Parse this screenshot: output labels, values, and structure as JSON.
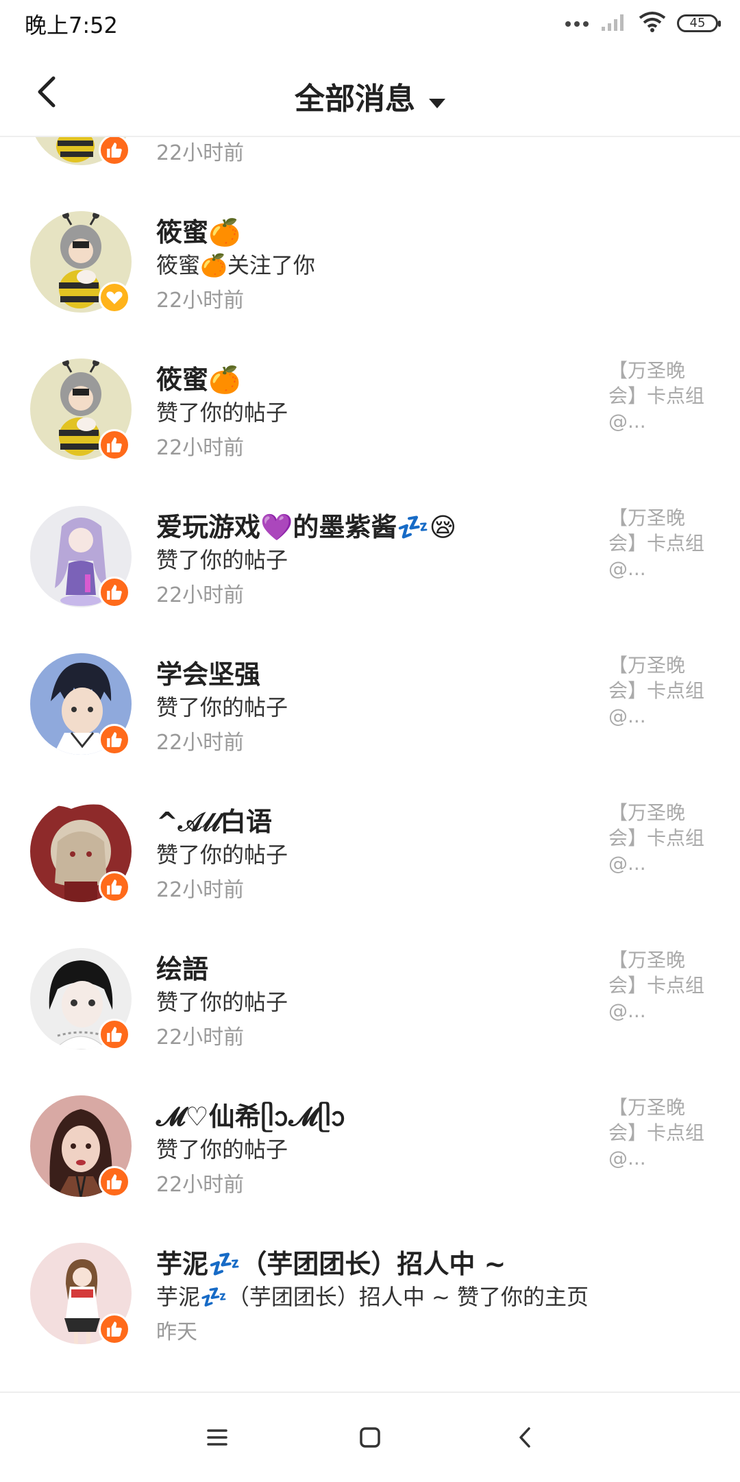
{
  "status_bar": {
    "time": "晚上7:52",
    "battery": "45"
  },
  "header": {
    "title": "全部消息"
  },
  "notifications": [
    {
      "name": "",
      "action": "",
      "time": "22小时前",
      "ref": []
    },
    {
      "name": "筱蜜🍊",
      "action": "筱蜜🍊关注了你",
      "time": "22小时前",
      "ref": []
    },
    {
      "name": "筱蜜🍊",
      "action": "赞了你的帖子",
      "time": "22小时前",
      "ref": [
        "【万圣晚",
        "会】卡点组",
        "@..."
      ]
    },
    {
      "name": "爱玩游戏💜的墨紫酱💤😪",
      "action": "赞了你的帖子",
      "time": "22小时前",
      "ref": [
        "【万圣晚",
        "会】卡点组",
        "@..."
      ]
    },
    {
      "name": "学会坚强",
      "action": "赞了你的帖子",
      "time": "22小时前",
      "ref": [
        "【万圣晚",
        "会】卡点组",
        "@..."
      ]
    },
    {
      "name": "^𝒜𝓁𝓁白语",
      "action": "赞了你的帖子",
      "time": "22小时前",
      "ref": [
        "【万圣晚",
        "会】卡点组",
        "@..."
      ]
    },
    {
      "name": "绘語",
      "action": "赞了你的帖子",
      "time": "22小时前",
      "ref": [
        "【万圣晚",
        "会】卡点组",
        "@..."
      ]
    },
    {
      "name": "𝓜♡仙希ᥫᩣ𝓜ᥫᩣ",
      "action": "赞了你的帖子",
      "time": "22小时前",
      "ref": [
        "【万圣晚",
        "会】卡点组",
        "@..."
      ]
    },
    {
      "name": "芋泥💤（芋团团长）招人中 ~",
      "action": "芋泥💤（芋团团长）招人中 ~ 赞了你的主页",
      "time": "昨天",
      "ref": []
    }
  ],
  "colors": {
    "like_badge": "#ff6a1a",
    "follow_badge": "#ffb31a",
    "time_text": "#999999",
    "ref_text": "#aaaaaa"
  },
  "icons": {
    "back": "chevron-left-icon",
    "dropdown": "caret-down-icon",
    "like": "thumbs-up-icon",
    "follow": "heart-icon",
    "menu": "menu-icon",
    "home": "home-square-icon",
    "nav_back": "nav-back-icon"
  }
}
